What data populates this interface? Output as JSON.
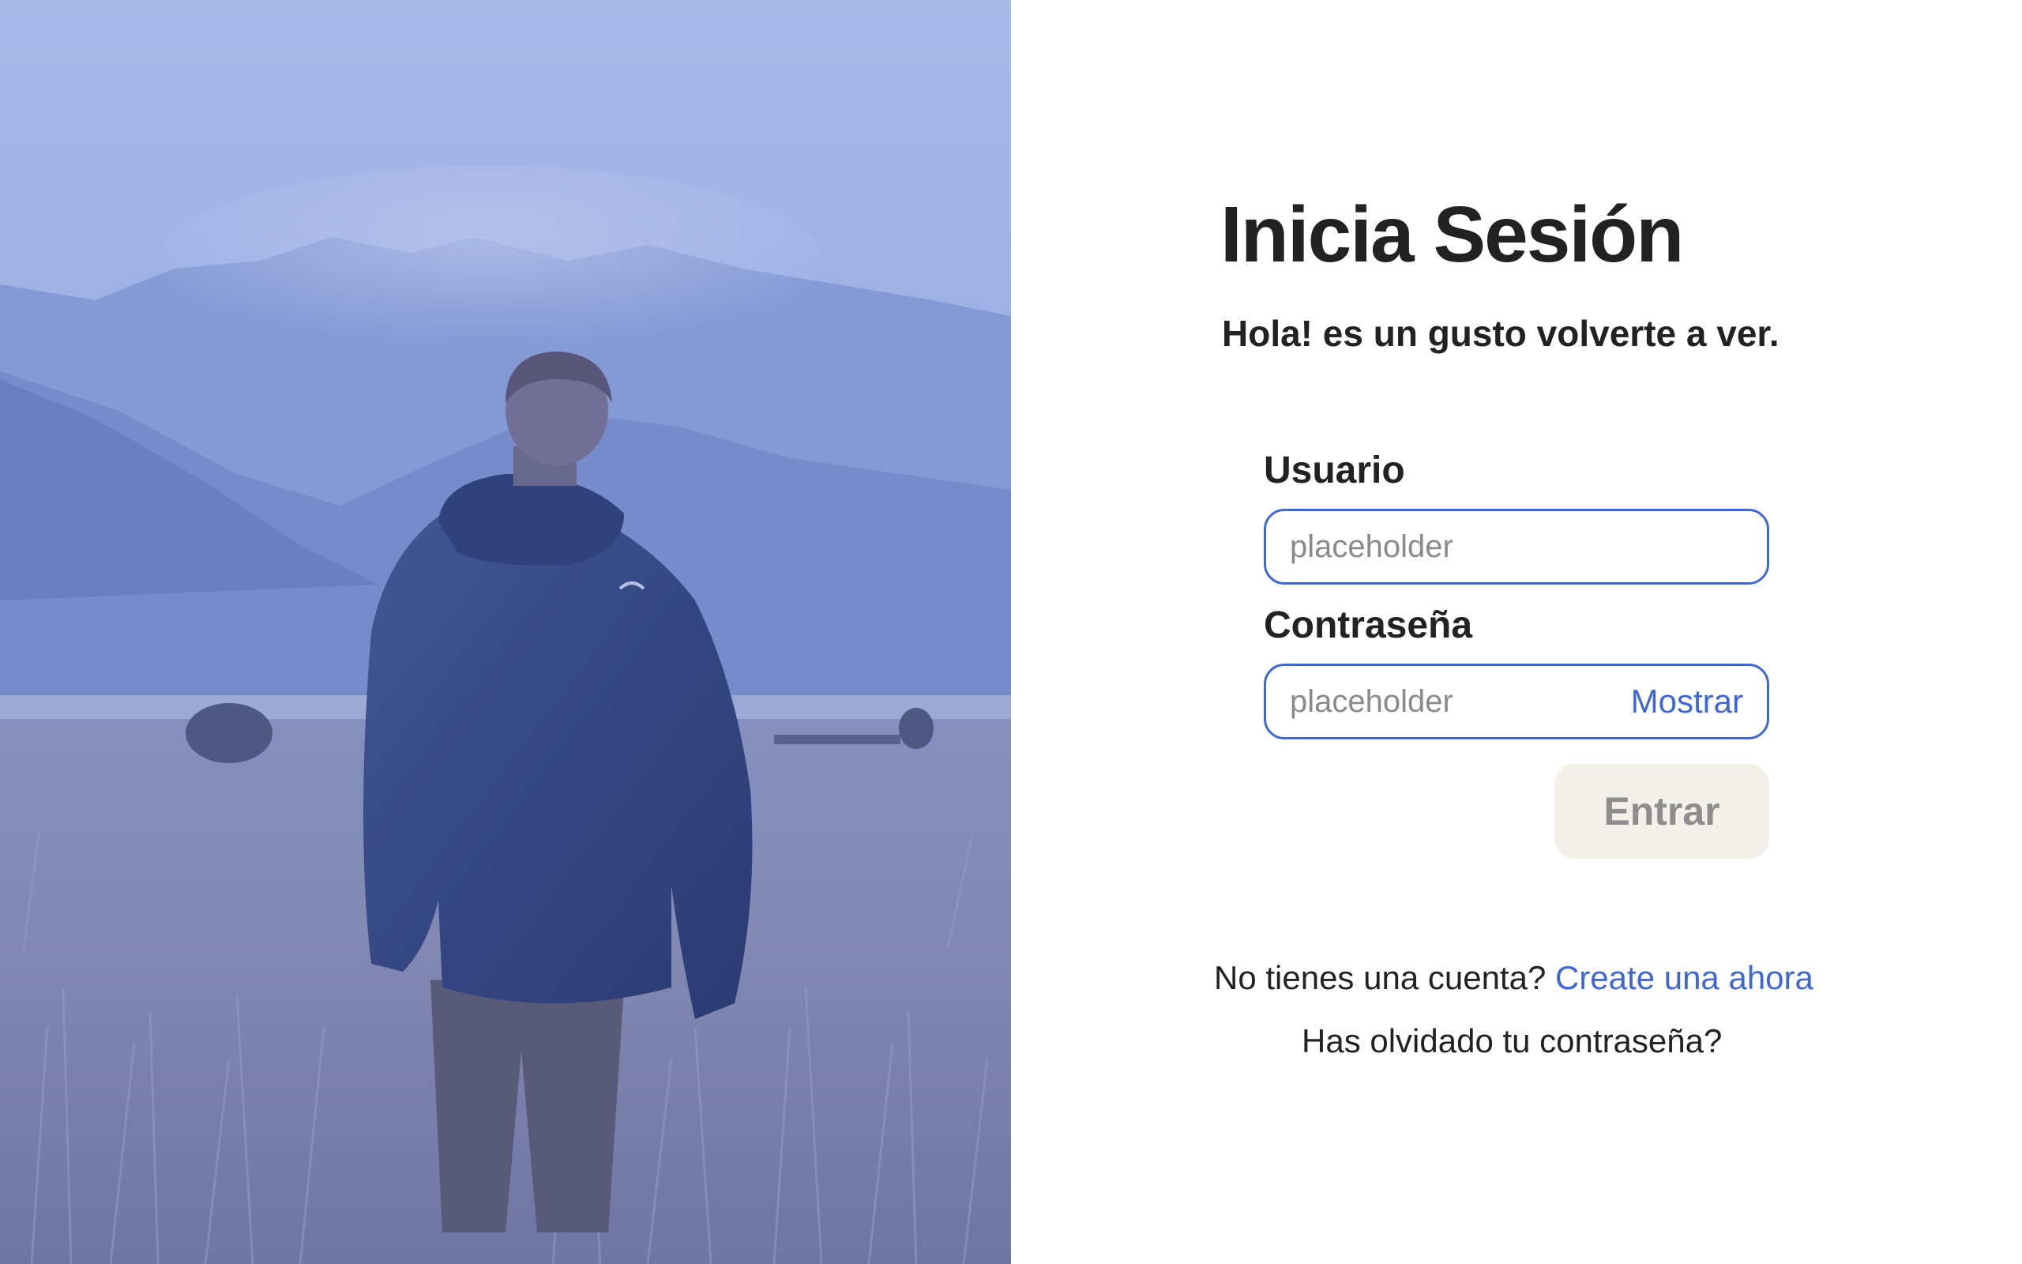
{
  "hero": {
    "image_description": "person-in-jacket-field-mountains-icon",
    "tint_color": "#8ea6e6"
  },
  "login": {
    "title": "Inicia Sesión",
    "subtitle": "Hola! es un gusto volverte a ver.",
    "username": {
      "label": "Usuario",
      "placeholder": "placeholder",
      "value": ""
    },
    "password": {
      "label": "Contraseña",
      "placeholder": "placeholder",
      "value": "",
      "toggle_label": "Mostrar"
    },
    "submit_label": "Entrar",
    "signup_prompt": "No tienes una cuenta?",
    "signup_link": "Create una ahora",
    "forgot_password": "Has olvidado tu contraseña?"
  },
  "colors": {
    "accent": "#3f67d2",
    "button_bg": "#f3efe9",
    "button_text": "#8e8e8e",
    "text": "#222222"
  }
}
